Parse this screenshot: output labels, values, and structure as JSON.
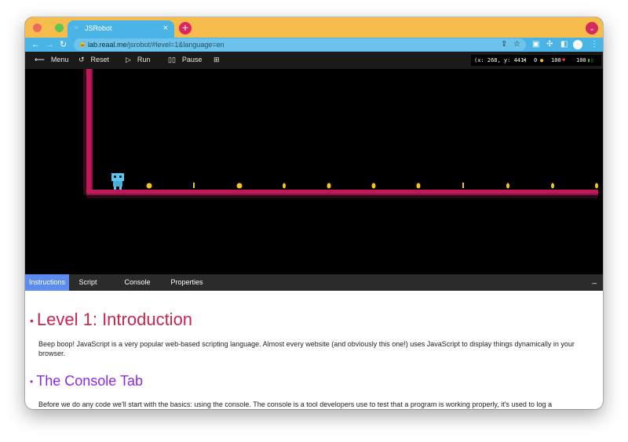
{
  "browser": {
    "tab_title": "JSRobot",
    "url_host": "lab.reaal.me",
    "url_path": "/jsrobot/#level=1&language=en",
    "new_tab_label": "+",
    "close_tab_label": "×"
  },
  "toolbar": {
    "menu_label": "Menu",
    "reset_label": "Reset",
    "run_label": "Run",
    "pause_label": "Pause"
  },
  "stats": {
    "coords": "(x: 268, y: 441)",
    "coins": "0",
    "health": "100",
    "battery": "100"
  },
  "panel": {
    "tabs": [
      "Instructions",
      "Script",
      "Console",
      "Properties"
    ],
    "minimize_label": "_"
  },
  "instructions": {
    "heading1": "Level 1: Introduction",
    "paragraph1": "Beep boop! JavaScript is a very popular web-based scripting language. Almost every website (and obviously this one!) uses JavaScript to display things dynamically in your browser.",
    "heading2": "The Console Tab",
    "paragraph2": "Before we do any code we'll start with the basics: using the console. The console is a tool developers use to test that a program is working properly, it's used to log a"
  },
  "colors": {
    "titlebar": "#f6bd4d",
    "chrome_blue": "#4bb4e6",
    "heading1": "#c9264f",
    "heading2": "#8a2be2",
    "active_tab": "#5b8def",
    "ground": "#c2185b"
  },
  "icons": {
    "back": "arrow-left-icon",
    "reset": "reset-icon",
    "run": "play-icon",
    "pause": "pause-icon",
    "grid": "grid-icon",
    "cursor": "cursor-icon",
    "coin": "coin-icon",
    "heart": "heart-icon",
    "battery": "battery-icon"
  }
}
